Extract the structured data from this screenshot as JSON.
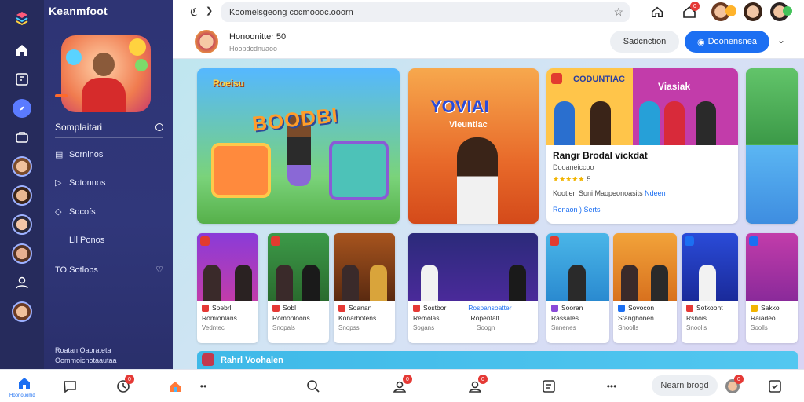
{
  "app": {
    "brand": "Keanmfoot"
  },
  "browser": {
    "url": "Koomelsgeong cocmoooc.ooorn"
  },
  "sidebar": {
    "hero_badge": "",
    "section_title": "Somplaitari",
    "items": [
      {
        "icon": "list-icon",
        "label": "Sorninos"
      },
      {
        "icon": "chat-icon",
        "label": "Sotonnos"
      },
      {
        "icon": "tag-icon",
        "label": "Socofs"
      },
      {
        "icon": "chart-icon",
        "label": "Lll Ponos"
      },
      {
        "icon": "send-icon",
        "label": "TO Sotlobs"
      }
    ],
    "footer_line1": "Roatan Oaorateta",
    "footer_line2": "Oommoicnotaautaa"
  },
  "header": {
    "name": "Honoonitter 50",
    "sub": "Hoopdcdnuaoo",
    "secondary_button": "Sadcnction",
    "primary_button": "Doonensnea"
  },
  "big_cards": {
    "card1_top": "Roeisu",
    "card1_title": "BOODBI",
    "card2_title": "YOVIAI",
    "card2_sub": "Vieuntiac"
  },
  "featured": {
    "img_title1": "CODUNTIAC",
    "img_title2": "Viasiak",
    "title": "Rangr Brodal vickdat",
    "line2": "Dooaneiccoo",
    "rating": "★★★★★",
    "rating_sub": "5",
    "line4": "Kootien Soni Maopeonoasits",
    "line4_link": "Ndeen",
    "line5": "Ronaon ) Serts"
  },
  "small_cards": [
    {
      "label": "Soebrl",
      "title": "Romionlans",
      "meta": "Vedntec"
    },
    {
      "label": "Sobl",
      "title": "Romonloons",
      "meta": "Snopals"
    },
    {
      "label": "Soanan",
      "title": "Konarhotens",
      "meta": "Snopss"
    },
    {
      "label": "Sostbor",
      "title": "Remolas",
      "meta": "Sogans"
    },
    {
      "label": "Rospansoatter",
      "title": "Ropenfalt",
      "meta": "Soogn"
    },
    {
      "label": "Sooran",
      "title": "Rassales",
      "meta": "Snnenes"
    },
    {
      "label": "Sovocon",
      "title": "Stanghonen",
      "meta": "Snoolls"
    },
    {
      "label": "Sotkoont",
      "title": "Rsnois",
      "meta": "Snoolls"
    },
    {
      "label": "Sakkol",
      "title": "Raiadeo",
      "meta": "Soolls"
    }
  ],
  "banner": {
    "title": "Rahrl Voohalen"
  },
  "bottombar": {
    "home_label": "Hoonouomd",
    "pill": "Nearn brogd",
    "badges": [
      "0",
      "0",
      "0",
      "0",
      "0"
    ]
  },
  "colors": {
    "accent": "#1c6ff2",
    "sidebar": "#2e3474",
    "rail": "#262b5c",
    "badge": "#e53935"
  }
}
